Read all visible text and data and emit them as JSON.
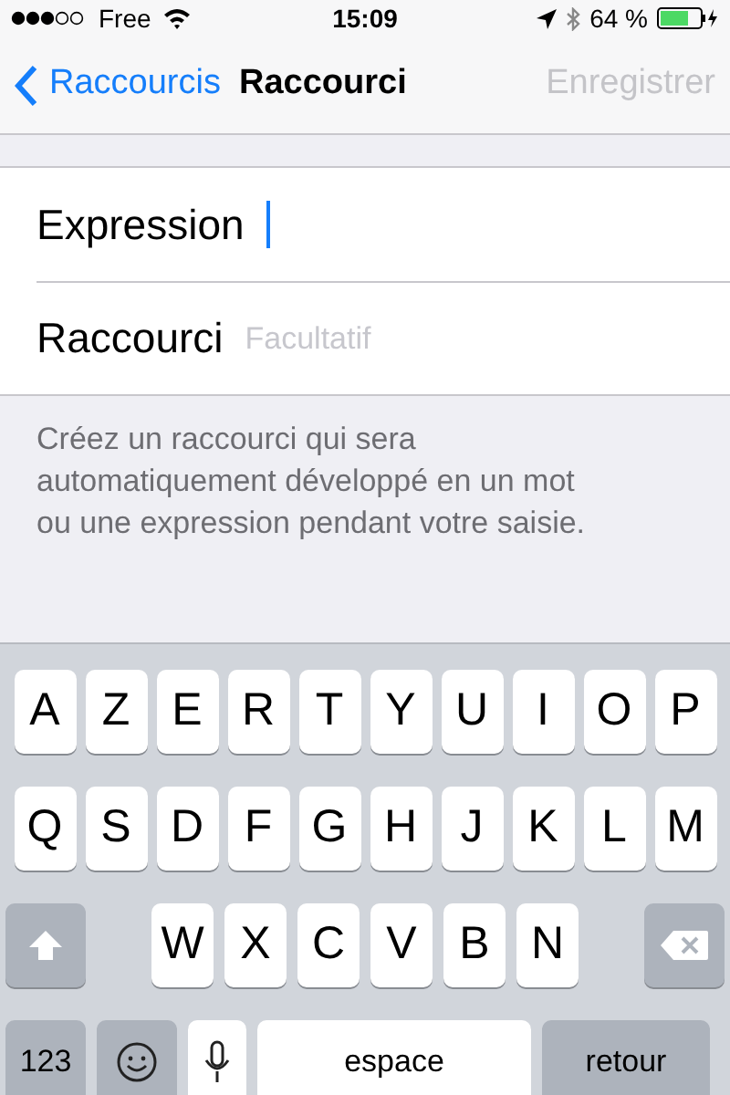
{
  "status_bar": {
    "carrier": "Free",
    "time": "15:09",
    "battery": "64 %"
  },
  "nav": {
    "back": "Raccourcis",
    "title": "Raccourci",
    "action": "Enregistrer",
    "action_disabled": true
  },
  "fields": [
    {
      "label": "Expression",
      "focused": true
    },
    {
      "label": "Raccourci",
      "placeholder": "Facultatif",
      "focused": false
    }
  ],
  "footer": "Créez un raccourci qui sera automatiquement développé en un mot ou une expression pendant votre saisie.",
  "keyboard": [
    [
      {
        "kind": "letter",
        "label": "A"
      },
      {
        "kind": "letter",
        "label": "Z"
      },
      {
        "kind": "letter",
        "label": "E"
      },
      {
        "kind": "letter",
        "label": "R"
      },
      {
        "kind": "letter",
        "label": "T"
      },
      {
        "kind": "letter",
        "label": "Y"
      },
      {
        "kind": "letter",
        "label": "U"
      },
      {
        "kind": "letter",
        "label": "I"
      },
      {
        "kind": "letter",
        "label": "O"
      },
      {
        "kind": "letter",
        "label": "P"
      }
    ],
    [
      {
        "kind": "letter",
        "label": "Q"
      },
      {
        "kind": "letter",
        "label": "S"
      },
      {
        "kind": "letter",
        "label": "D"
      },
      {
        "kind": "letter",
        "label": "F"
      },
      {
        "kind": "letter",
        "label": "G"
      },
      {
        "kind": "letter",
        "label": "H"
      },
      {
        "kind": "letter",
        "label": "J"
      },
      {
        "kind": "letter",
        "label": "K"
      },
      {
        "kind": "letter",
        "label": "L"
      },
      {
        "kind": "letter",
        "label": "M"
      }
    ],
    [
      {
        "kind": "shift"
      },
      {
        "kind": "letter",
        "label": "W"
      },
      {
        "kind": "letter",
        "label": "X"
      },
      {
        "kind": "letter",
        "label": "C"
      },
      {
        "kind": "letter",
        "label": "V"
      },
      {
        "kind": "letter",
        "label": "B"
      },
      {
        "kind": "letter",
        "label": "N"
      },
      {
        "kind": "delete"
      }
    ],
    [
      {
        "kind": "numbers",
        "label": "123"
      },
      {
        "kind": "emoji"
      },
      {
        "kind": "mic"
      },
      {
        "kind": "space",
        "label": "espace"
      },
      {
        "kind": "return",
        "label": "retour"
      }
    ]
  ]
}
